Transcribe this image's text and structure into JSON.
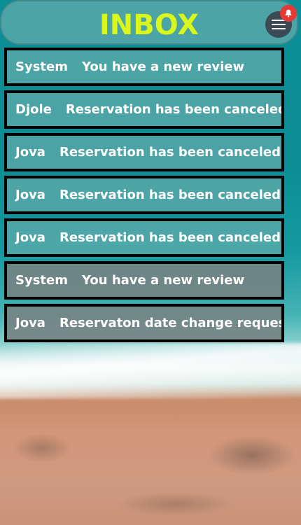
{
  "header": {
    "title": "INBOX",
    "title_color": "#d9f71a",
    "menu_icon": "hamburger-icon",
    "notification_icon": "bell-icon"
  },
  "messages": [
    {
      "sender": "System",
      "text": "You have a new review",
      "read": false
    },
    {
      "sender": "Djole",
      "text": "Reservation has been canceled",
      "read": false
    },
    {
      "sender": "Jova",
      "text": "Reservation has been canceled",
      "read": false
    },
    {
      "sender": "Jova",
      "text": "Reservation has been canceled",
      "read": false
    },
    {
      "sender": "Jova",
      "text": "Reservation has been canceled",
      "read": false
    },
    {
      "sender": "System",
      "text": "You have a new review",
      "read": true
    },
    {
      "sender": "Jova",
      "text": "Reservaton date change request",
      "read": true
    }
  ],
  "colors": {
    "unread_bg": "#5aa8a8",
    "read_bg": "#788282",
    "border": "#000000",
    "text": "#ffffff",
    "notification_badge": "#e53935"
  }
}
